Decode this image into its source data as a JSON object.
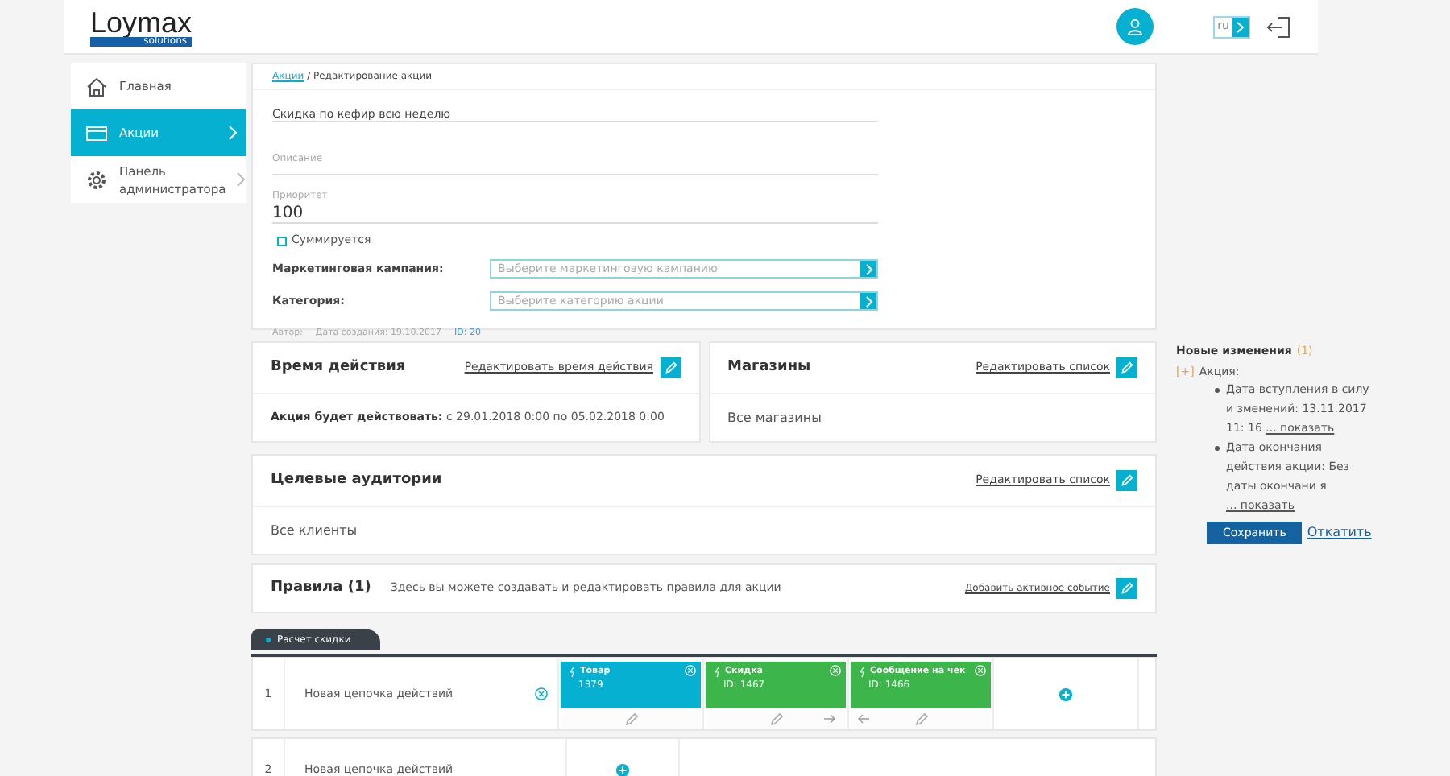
{
  "header": {
    "logo": "Loymax",
    "logo_sub": "solutions",
    "language": "ru"
  },
  "sidebar": {
    "items": [
      {
        "label": "Главная",
        "selected": false,
        "arrow": false
      },
      {
        "label": "Акции",
        "selected": true,
        "arrow": true
      },
      {
        "label": "Панель администратора",
        "selected": false,
        "arrow": true
      }
    ]
  },
  "breadcrumb": {
    "link": "Акции",
    "current": "/ Редактирование акции"
  },
  "form": {
    "name_value": "Скидка по кефир всю неделю",
    "description_placeholder": "Описание",
    "priority_label": "Приоритет",
    "priority_value": "100",
    "summable": {
      "label": "Суммируется",
      "checked": false
    },
    "selects": [
      {
        "label": "Маркетинговая кампания:",
        "placeholder": "Выберите маркетинговую кампанию"
      },
      {
        "label": "Категория:",
        "placeholder": "Выберите категорию акции"
      }
    ],
    "meta": {
      "author": "Автор:",
      "created": "Дата создания: 19.10.2017",
      "id": "ID: 20"
    }
  },
  "time_card": {
    "title": "Время действия",
    "action": "Редактировать время действия",
    "body_bold": "Акция будет действовать:",
    "body": "с 29.01.2018 0:00 по 05.02.2018 0:00"
  },
  "stores_card": {
    "title": "Магазины",
    "action": "Редактировать список",
    "body": "Все магазины"
  },
  "audience_card": {
    "title": "Целевые аудитории",
    "action": "Редактировать список",
    "body": "Все клиенты"
  },
  "rules_card": {
    "title": "Правила (1)",
    "subtitle": "Здесь вы можете создавать и редактировать правила для акции",
    "action": "Добавить активное событие"
  },
  "rule_tab": "Расчет скидки",
  "chains": [
    {
      "number": "1",
      "name": "Новая цепочка действий",
      "blocks": [
        {
          "title": "Товар",
          "id": "1379",
          "color": "#06b0d1",
          "left_arrow": false,
          "right_arrow": false
        },
        {
          "title": "Скидка",
          "id": "ID: 1467",
          "color": "#3cb54a",
          "left_arrow": false,
          "right_arrow": true
        },
        {
          "title": "Сообщение на чек",
          "id": "ID: 1466",
          "color": "#3cb54a",
          "left_arrow": true,
          "right_arrow": false
        }
      ]
    },
    {
      "number": "2",
      "name": "Новая цепочка действий"
    }
  ],
  "changes": {
    "title": "Новые изменения",
    "count": "(1)",
    "toggle": "[+]",
    "group": "Акция:",
    "items": [
      {
        "text": "Дата вступления в силу и зменений: 13.11.2017 11: 16",
        "link": "... показать"
      },
      {
        "text": "Дата окончания действия акции: Без даты окончани я",
        "link": "... показать"
      }
    ],
    "save": "Сохранить",
    "revert": "Откатить"
  }
}
